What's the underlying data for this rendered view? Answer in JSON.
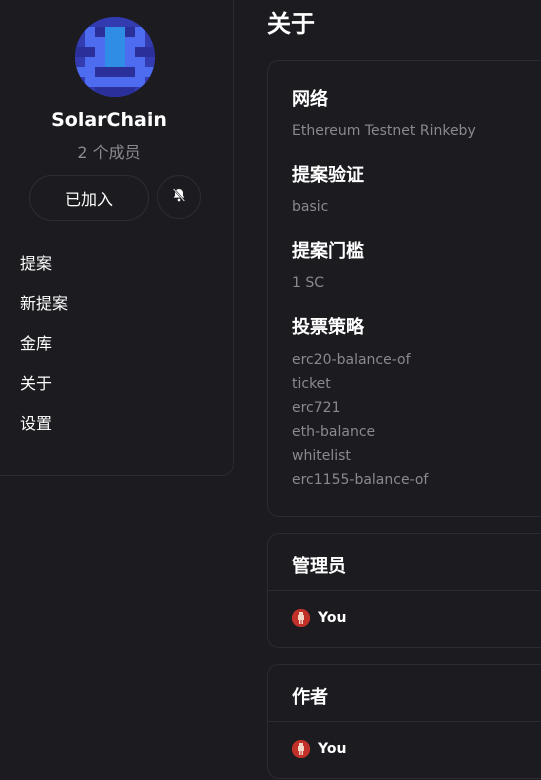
{
  "sidebar": {
    "space_name": "SolarChain",
    "members": "2 个成员",
    "join_label": "已加入",
    "nav": [
      {
        "label": "提案"
      },
      {
        "label": "新提案"
      },
      {
        "label": "金库"
      },
      {
        "label": "关于"
      },
      {
        "label": "设置"
      }
    ]
  },
  "main": {
    "title": "关于",
    "about": {
      "network_title": "网络",
      "network_value": "Ethereum Testnet Rinkeby",
      "validation_title": "提案验证",
      "validation_value": "basic",
      "threshold_title": "提案门槛",
      "threshold_value": "1 SC",
      "strategies_title": "投票策略",
      "strategies": [
        "erc20-balance-of",
        "ticket",
        "erc721",
        "eth-balance",
        "whitelist",
        "erc1155-balance-of"
      ]
    },
    "admins": {
      "title": "管理员",
      "user": "You"
    },
    "authors": {
      "title": "作者",
      "user": "You"
    }
  },
  "colors": {
    "background": "#1c1b20",
    "border": "#2c2b31",
    "muted_text": "#8a8990",
    "avatar_blue": "#3a52e0",
    "user_avatar_red": "#c2302a"
  },
  "icons": {
    "bell": "bell-off-icon",
    "space_avatar": "space-avatar-icon",
    "user_avatar": "user-avatar-icon"
  }
}
